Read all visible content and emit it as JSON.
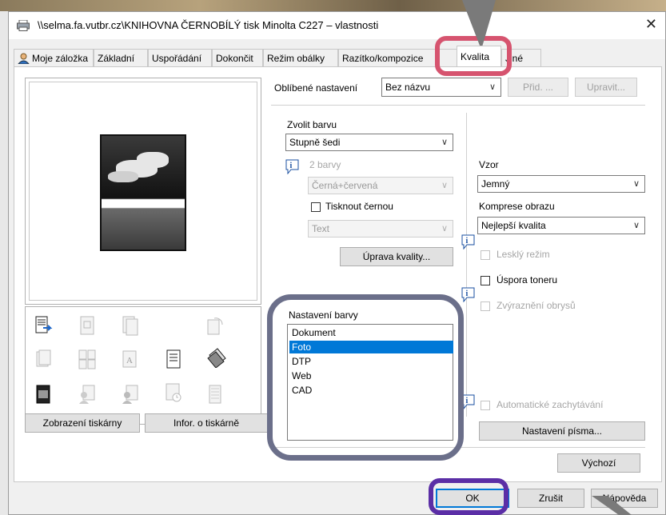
{
  "window": {
    "title": "\\\\selma.fa.vutbr.cz\\KNIHOVNA ČERNOBÍLÝ tisk Minolta C227 – vlastnosti",
    "close_glyph": "✕"
  },
  "tabs": [
    {
      "label": "Moje záložka"
    },
    {
      "label": "Základní"
    },
    {
      "label": "Uspořádání"
    },
    {
      "label": "Dokončit"
    },
    {
      "label": "Režim obálky"
    },
    {
      "label": "Razítko/kompozice"
    },
    {
      "label": "Kvalita"
    },
    {
      "label": "Jiné"
    }
  ],
  "active_tab": "Kvalita",
  "favorites": {
    "label": "Oblíbené nastavení",
    "value": "Bez názvu",
    "add_label": "Přid. ...",
    "edit_label": "Upravit..."
  },
  "left": {
    "printer_view_label": "Zobrazení tiskárny",
    "printer_info_label": "Infor. o tiskárně"
  },
  "color": {
    "select_label": "Zvolit barvu",
    "select_value": "Stupně šedi",
    "two_colors_label": "2 barvy",
    "two_colors_value": "Černá+červená",
    "print_black_label": "Tisknout černou",
    "print_black_value": "Text",
    "quality_button": "Úprava kvality..."
  },
  "color_settings": {
    "label": "Nastavení barvy",
    "items": [
      "Dokument",
      "Foto",
      "DTP",
      "Web",
      "CAD"
    ],
    "selected": "Foto"
  },
  "pattern": {
    "label": "Vzor",
    "value": "Jemný"
  },
  "compression": {
    "label": "Komprese obrazu",
    "value": "Nejlepší kvalita"
  },
  "options": {
    "gloss": "Lesklý režim",
    "toner_save": "Úspora toneru",
    "edge": "Zvýraznění obrysů",
    "auto_trap": "Automatické zachytávání",
    "font_settings": "Nastavení písma..."
  },
  "footer": {
    "default_label": "Výchozí",
    "ok_label": "OK",
    "cancel_label": "Zrušit",
    "help_label": "Nápověda"
  },
  "colors": {
    "accent": "#0078d7",
    "ring_pink": "#d6546f",
    "ring_slate": "#6b6f8a",
    "ring_purple": "#5b2ea6"
  }
}
